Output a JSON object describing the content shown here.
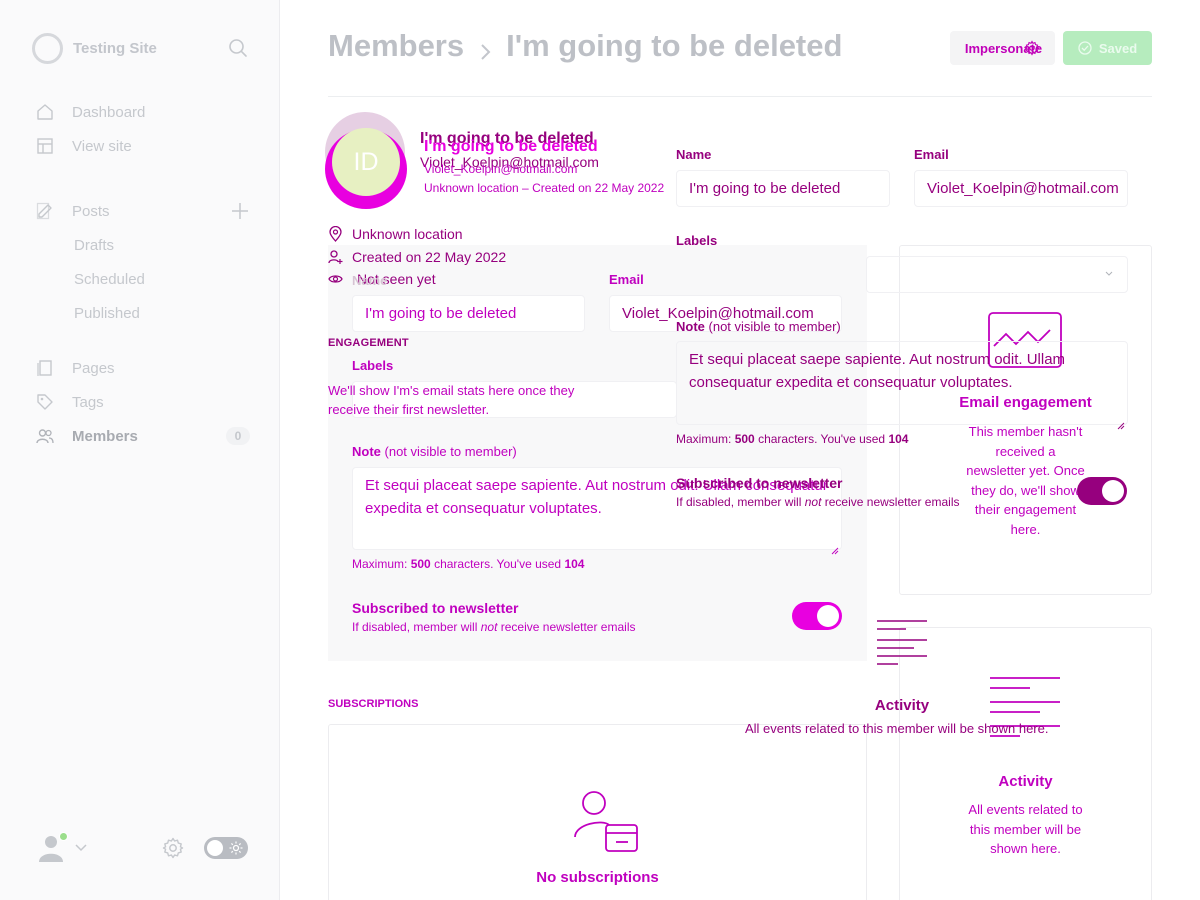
{
  "sidebar": {
    "site_name": "Testing Site",
    "nav_main": [
      {
        "label": "Dashboard",
        "icon": "home-icon"
      },
      {
        "label": "View site",
        "icon": "layout-icon"
      }
    ],
    "posts": {
      "label": "Posts",
      "icon": "pen-icon"
    },
    "post_subitems": [
      {
        "label": "Drafts"
      },
      {
        "label": "Scheduled"
      },
      {
        "label": "Published"
      }
    ],
    "nav_secondary": [
      {
        "label": "Pages",
        "icon": "page-icon"
      },
      {
        "label": "Tags",
        "icon": "tag-icon"
      }
    ],
    "members": {
      "label": "Members",
      "icon": "members-icon",
      "count": "0"
    }
  },
  "header": {
    "breadcrumb_parent": "Members",
    "breadcrumb_current": "I'm going to be deleted",
    "impersonate_label": "Impersonate",
    "saved_label": "Saved"
  },
  "member": {
    "initials": "ID",
    "name": "I'm going to be deleted",
    "email": "Violet_Koelpin@hotmail.com",
    "subtitle": "Unknown location – Created on 22 May 2022",
    "location": "Unknown location",
    "created": "Created on 22 May 2022",
    "seen": "Not seen yet"
  },
  "form": {
    "name_label": "Name",
    "name_value": "I'm going to be deleted",
    "email_label": "Email",
    "email_value": "Violet_Koelpin@hotmail.com",
    "labels_label": "Labels",
    "note_label": "Note",
    "note_suffix": "(not visible to member)",
    "note_value": "Et sequi placeat saepe sapiente. Aut nostrum odit. Ullam consequatur expedita et consequatur voluptates.",
    "note_value_back": "Et sequi placeat saepe sapiente. Aut nostrum odit. Ullam consequatur expedita et consequatur voluptates.",
    "note_hint_prefix": "Maximum:",
    "note_hint_max": "500",
    "note_hint_mid": "characters. You've used",
    "note_hint_used": "104",
    "newsletter_label": "Subscribed to newsletter",
    "newsletter_hint_a": "If disabled, member will",
    "newsletter_hint_not": "not",
    "newsletter_hint_b": "receive newsletter emails",
    "newsletter_enabled": true
  },
  "engagement": {
    "heading": "ENGAGEMENT",
    "empty_text": "We'll show I'm's email stats here once they receive their first newsletter.",
    "card_title": "Email engagement",
    "card_text": "This member hasn't received a newsletter yet. Once they do, we'll show their engagement here."
  },
  "subscriptions": {
    "heading": "SUBSCRIPTIONS",
    "empty_title": "No subscriptions"
  },
  "activity": {
    "title": "Activity",
    "text": "All events related to this member will be shown here."
  },
  "colors": {
    "accent": "#c000bf",
    "accent_dark": "#96007e",
    "saved_green": "#b6ecbe",
    "toggle_on": "#e800e0"
  }
}
